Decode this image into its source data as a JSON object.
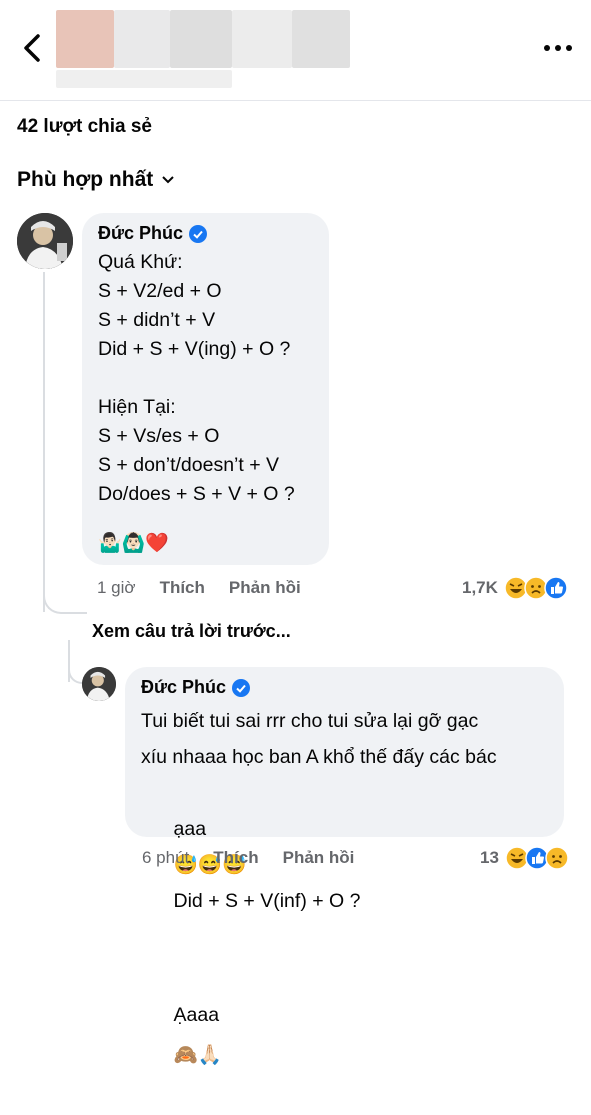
{
  "header": {
    "blur_colors": [
      "#e8c4b8",
      "#e9e9ea",
      "#dedede",
      "#ececec",
      "#e0e0e0",
      "#efefef"
    ]
  },
  "shares_text": "42 lượt chia sẻ",
  "sort_label": "Phù hợp nhất",
  "comment1": {
    "author": "Đức Phúc",
    "lines": [
      "Quá Khứ:",
      "S + V2/ed + O",
      "S + didn’t + V",
      "Did + S + V(ing) + O ?",
      "",
      "Hiện Tại:",
      "S + Vs/es + O",
      "S + don’t/doesn’t + V",
      "Do/does + S + V + O ?"
    ],
    "emojis": "🤷🏻‍♂️🙆🏻‍♂️❤️",
    "time": "1 giờ",
    "like": "Thích",
    "reply": "Phản hồi",
    "reaction_count": "1,7K"
  },
  "view_previous": "Xem câu trả lời trước...",
  "comment2": {
    "author": "Đức Phúc",
    "line1": "Tui biết tui sai rrr cho tui sửa lại gỡ gạc",
    "line2": "xíu nhaaa học ban A khổ thế đấy các bác",
    "line3_prefix": "ạaa",
    "line3_emojis": "😅😅😅",
    "line3_suffix": "Did + S + V(inf) + O ?",
    "line4_text": "Ạaaa",
    "line4_emojis": "🙈🙏🏻",
    "time": "6 phút",
    "like": "Thích",
    "reply": "Phản hồi",
    "reaction_count": "13"
  },
  "colors": {
    "verified": "#1877f2",
    "like_blue": "#1877f2",
    "haha_yellow": "#f7b928"
  }
}
